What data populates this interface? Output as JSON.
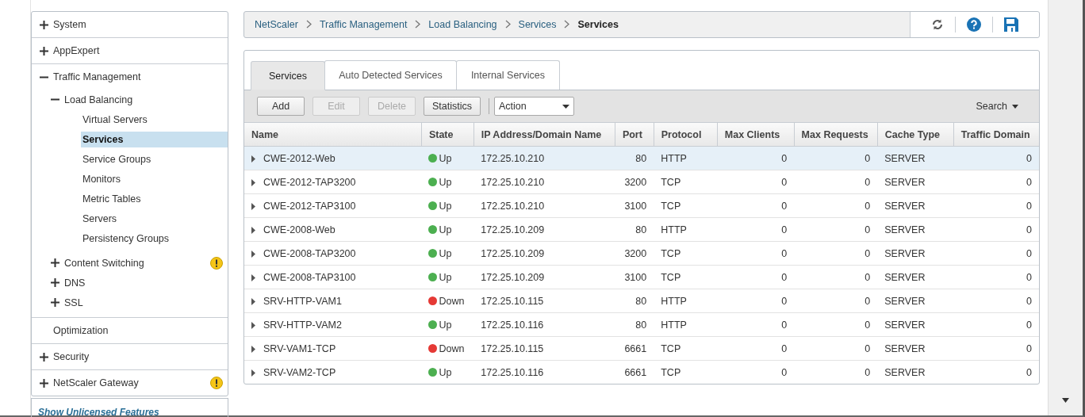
{
  "sidebar": {
    "sections": [
      {
        "label": "System",
        "kind": "group",
        "expanded": false,
        "warning": false
      },
      {
        "label": "AppExpert",
        "kind": "group",
        "expanded": false,
        "warning": false
      },
      {
        "label": "Traffic Management",
        "kind": "group",
        "expanded": true,
        "warning": false,
        "children": [
          {
            "label": "Load Balancing",
            "kind": "group",
            "expanded": true,
            "warning": false,
            "children": [
              {
                "label": "Virtual Servers",
                "kind": "leaf",
                "selected": false
              },
              {
                "label": "Services",
                "kind": "leaf",
                "selected": true
              },
              {
                "label": "Service Groups",
                "kind": "leaf",
                "selected": false
              },
              {
                "label": "Monitors",
                "kind": "leaf",
                "selected": false
              },
              {
                "label": "Metric Tables",
                "kind": "leaf",
                "selected": false
              },
              {
                "label": "Servers",
                "kind": "leaf",
                "selected": false
              },
              {
                "label": "Persistency Groups",
                "kind": "leaf",
                "selected": false
              }
            ]
          },
          {
            "label": "Content Switching",
            "kind": "group",
            "expanded": false,
            "warning": true
          },
          {
            "label": "DNS",
            "kind": "group",
            "expanded": false,
            "warning": false
          },
          {
            "label": "SSL",
            "kind": "group",
            "expanded": false,
            "warning": false
          }
        ]
      },
      {
        "label": "Optimization",
        "kind": "leaf",
        "selected": false
      },
      {
        "label": "Security",
        "kind": "group",
        "expanded": false,
        "warning": false
      },
      {
        "label": "NetScaler Gateway",
        "kind": "group",
        "expanded": false,
        "warning": true
      }
    ],
    "footer_link": "Show Unlicensed Features"
  },
  "breadcrumb": [
    "NetScaler",
    "Traffic Management",
    "Load Balancing",
    "Services",
    "Services"
  ],
  "tabs": [
    {
      "label": "Services",
      "selected": true
    },
    {
      "label": "Auto Detected Services",
      "selected": false
    },
    {
      "label": "Internal Services",
      "selected": false
    }
  ],
  "toolbar": {
    "buttons": [
      {
        "label": "Add",
        "disabled": false
      },
      {
        "label": "Edit",
        "disabled": true
      },
      {
        "label": "Delete",
        "disabled": true
      },
      {
        "label": "Statistics",
        "disabled": false
      }
    ],
    "action": "Action",
    "search": "Search"
  },
  "table": {
    "columns": [
      "Name",
      "State",
      "IP Address/Domain Name",
      "Port",
      "Protocol",
      "Max Clients",
      "Max Requests",
      "Cache Type",
      "Traffic Domain"
    ],
    "rows": [
      {
        "name": "CWE-2012-Web",
        "state": "Up",
        "color": "#4caf50",
        "ip": "172.25.10.210",
        "port": "80",
        "protocol": "HTTP",
        "max_clients": "0",
        "max_requests": "0",
        "cache_type": "SERVER",
        "traffic_domain": "0",
        "selected": true
      },
      {
        "name": "CWE-2012-TAP3200",
        "state": "Up",
        "color": "#4caf50",
        "ip": "172.25.10.210",
        "port": "3200",
        "protocol": "TCP",
        "max_clients": "0",
        "max_requests": "0",
        "cache_type": "SERVER",
        "traffic_domain": "0",
        "selected": false
      },
      {
        "name": "CWE-2012-TAP3100",
        "state": "Up",
        "color": "#4caf50",
        "ip": "172.25.10.210",
        "port": "3100",
        "protocol": "TCP",
        "max_clients": "0",
        "max_requests": "0",
        "cache_type": "SERVER",
        "traffic_domain": "0",
        "selected": false
      },
      {
        "name": "CWE-2008-Web",
        "state": "Up",
        "color": "#4caf50",
        "ip": "172.25.10.209",
        "port": "80",
        "protocol": "HTTP",
        "max_clients": "0",
        "max_requests": "0",
        "cache_type": "SERVER",
        "traffic_domain": "0",
        "selected": false
      },
      {
        "name": "CWE-2008-TAP3200",
        "state": "Up",
        "color": "#4caf50",
        "ip": "172.25.10.209",
        "port": "3200",
        "protocol": "TCP",
        "max_clients": "0",
        "max_requests": "0",
        "cache_type": "SERVER",
        "traffic_domain": "0",
        "selected": false
      },
      {
        "name": "CWE-2008-TAP3100",
        "state": "Up",
        "color": "#4caf50",
        "ip": "172.25.10.209",
        "port": "3100",
        "protocol": "TCP",
        "max_clients": "0",
        "max_requests": "0",
        "cache_type": "SERVER",
        "traffic_domain": "0",
        "selected": false
      },
      {
        "name": "SRV-HTTP-VAM1",
        "state": "Down",
        "color": "#e53935",
        "ip": "172.25.10.115",
        "port": "80",
        "protocol": "HTTP",
        "max_clients": "0",
        "max_requests": "0",
        "cache_type": "SERVER",
        "traffic_domain": "0",
        "selected": false
      },
      {
        "name": "SRV-HTTP-VAM2",
        "state": "Up",
        "color": "#4caf50",
        "ip": "172.25.10.116",
        "port": "80",
        "protocol": "HTTP",
        "max_clients": "0",
        "max_requests": "0",
        "cache_type": "SERVER",
        "traffic_domain": "0",
        "selected": false
      },
      {
        "name": "SRV-VAM1-TCP",
        "state": "Down",
        "color": "#e53935",
        "ip": "172.25.10.115",
        "port": "6661",
        "protocol": "TCP",
        "max_clients": "0",
        "max_requests": "0",
        "cache_type": "SERVER",
        "traffic_domain": "0",
        "selected": false
      },
      {
        "name": "SRV-VAM2-TCP",
        "state": "Up",
        "color": "#4caf50",
        "ip": "172.25.10.116",
        "port": "6661",
        "protocol": "TCP",
        "max_clients": "0",
        "max_requests": "0",
        "cache_type": "SERVER",
        "traffic_domain": "0",
        "selected": false
      }
    ]
  }
}
